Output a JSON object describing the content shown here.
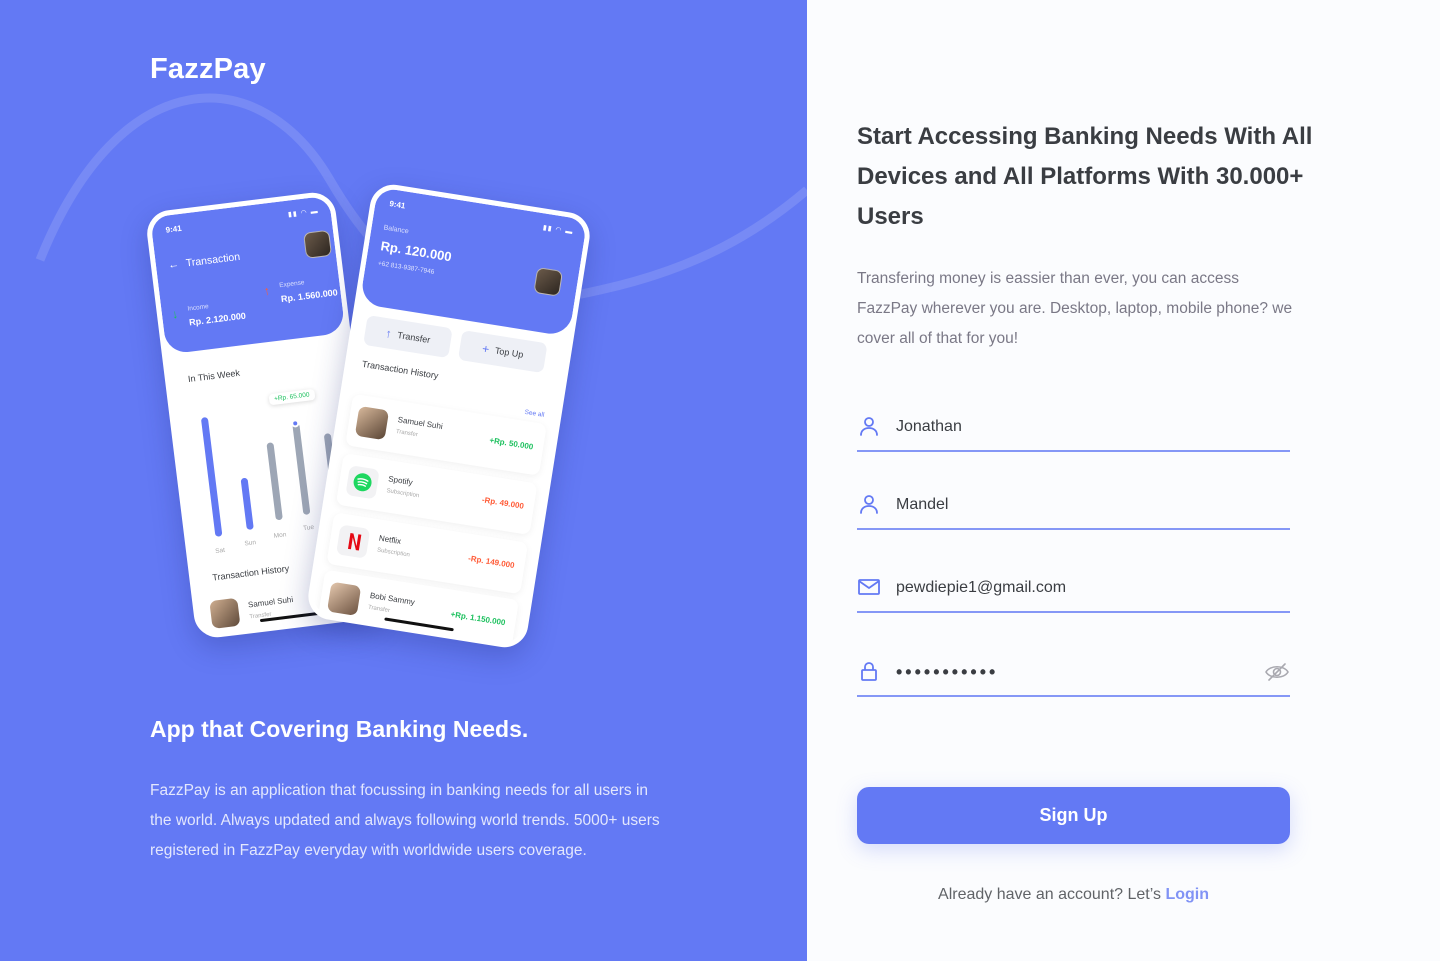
{
  "brand": "FazzPay",
  "left": {
    "title": "App that Covering Banking Needs.",
    "description": "FazzPay is an application that focussing in banking needs for all users in the world. Always updated and always following world trends. 5000+ users registered in FazzPay everyday with worldwide users coverage."
  },
  "phone_a": {
    "time": "9:41",
    "title": "Transaction",
    "income_label": "Income",
    "income_value": "Rp. 2.120.000",
    "expense_label": "Expense",
    "expense_value": "Rp. 1.560.000",
    "week_title": "In This Week",
    "tooltip": "+Rp. 65.000",
    "days": [
      "Sat",
      "Sun",
      "Mon",
      "Tue"
    ],
    "history_title": "Transaction History",
    "row_name": "Samuel Suhi",
    "row_sub": "Transfer"
  },
  "phone_b": {
    "time": "9:41",
    "balance_label": "Balance",
    "balance": "Rp. 120.000",
    "phone": "+62 813-9387-7946",
    "transfer_label": "Transfer",
    "topup_label": "Top Up",
    "history_title": "Transaction History",
    "see_all": "See all",
    "rows": [
      {
        "name": "Samuel Suhi",
        "sub": "Transfer",
        "amount": "+Rp. 50.000"
      },
      {
        "name": "Spotify",
        "sub": "Subscription",
        "amount": "-Rp. 49.000"
      },
      {
        "name": "Netflix",
        "sub": "Subscription",
        "amount": "-Rp. 149.000"
      },
      {
        "name": "Bobi Sammy",
        "sub": "Transfer",
        "amount": "+Rp. 1.150.000"
      }
    ]
  },
  "right": {
    "title": "Start Accessing Banking Needs With All Devices and All Platforms With 30.000+ Users",
    "description": "Transfering money is eassier than ever, you can access FazzPay wherever you are. Desktop, laptop, mobile phone? we cover all of that for you!"
  },
  "form": {
    "first_name": "Jonathan",
    "last_name": "Mandel",
    "email": "pewdiepie1@gmail.com",
    "password": "•••••••••••",
    "submit_label": "Sign Up",
    "login_prompt": "Already have an account? Let’s",
    "login_link": "Login"
  },
  "colors": {
    "primary": "#6379f4",
    "text": "#3a3d42",
    "muted": "#7a7886",
    "positive": "#1ec15f",
    "negative": "#ff5b37"
  }
}
